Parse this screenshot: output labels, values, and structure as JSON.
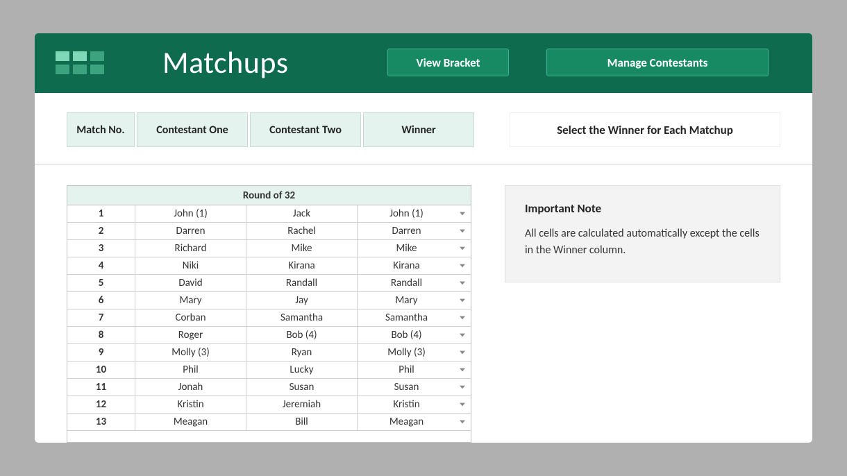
{
  "header": {
    "title": "Matchups",
    "view_bracket_label": "View Bracket",
    "manage_contestants_label": "Manage Contestants"
  },
  "columns": {
    "match_no": "Match No.",
    "contestant_one": "Contestant One",
    "contestant_two": "Contestant Two",
    "winner": "Winner"
  },
  "select_winner_heading": "Select the Winner for Each Matchup",
  "round_label": "Round of 32",
  "matches": [
    {
      "no": "1",
      "c1": "John  (1)",
      "c2": "Jack",
      "winner": "John  (1)"
    },
    {
      "no": "2",
      "c1": "Darren",
      "c2": "Rachel",
      "winner": "Darren"
    },
    {
      "no": "3",
      "c1": "Richard",
      "c2": "Mike",
      "winner": "Mike"
    },
    {
      "no": "4",
      "c1": "Niki",
      "c2": "Kirana",
      "winner": "Kirana"
    },
    {
      "no": "5",
      "c1": "David",
      "c2": "Randall",
      "winner": "Randall"
    },
    {
      "no": "6",
      "c1": "Mary",
      "c2": "Jay",
      "winner": "Mary"
    },
    {
      "no": "7",
      "c1": "Corban",
      "c2": "Samantha",
      "winner": "Samantha"
    },
    {
      "no": "8",
      "c1": "Roger",
      "c2": "Bob  (4)",
      "winner": "Bob  (4)"
    },
    {
      "no": "9",
      "c1": "Molly  (3)",
      "c2": "Ryan",
      "winner": "Molly  (3)"
    },
    {
      "no": "10",
      "c1": "Phil",
      "c2": "Lucky",
      "winner": "Phil"
    },
    {
      "no": "11",
      "c1": "Jonah",
      "c2": "Susan",
      "winner": "Susan"
    },
    {
      "no": "12",
      "c1": "Kristin",
      "c2": "Jeremiah",
      "winner": "Kristin"
    },
    {
      "no": "13",
      "c1": "Meagan",
      "c2": "Bill",
      "winner": "Meagan"
    }
  ],
  "note": {
    "title": "Important Note",
    "text": "All cells are calculated automatically except the cells in the Winner column."
  },
  "colors": {
    "header_bg": "#0f6b4e",
    "button_bg": "#178a63",
    "mint_bg": "#e4f3ed"
  }
}
